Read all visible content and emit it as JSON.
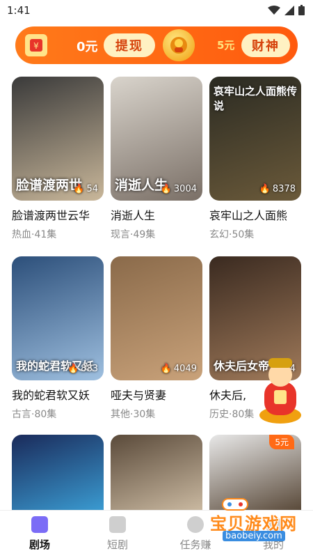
{
  "status_bar": {
    "time": "1:41"
  },
  "banner": {
    "balance": "0元",
    "withdraw_label": "提现",
    "reward": "5元",
    "god_label": "财神"
  },
  "dramas": [
    {
      "poster_title": "脸谱渡两世",
      "views": "54",
      "name": "脸谱渡两世云华",
      "meta": "热血·41集",
      "color1": "#3a3a3a",
      "color2": "#c9b79a"
    },
    {
      "poster_title": "消逝人生",
      "views": "3004",
      "name": "消逝人生",
      "meta": "现言·49集",
      "color1": "#d9d4cc",
      "color2": "#7a6f66"
    },
    {
      "poster_title": "哀牢山之人面熊传说",
      "views": "8378",
      "name": "哀牢山之人面熊",
      "meta": "玄幻·50集",
      "color1": "#2a2a22",
      "color2": "#6b5a3a"
    },
    {
      "poster_title": "我的蛇君软又妖",
      "views": "883",
      "name": "我的蛇君软又妖",
      "meta": "古言·80集",
      "color1": "#2c4f7a",
      "color2": "#9fc0e0"
    },
    {
      "poster_title": "",
      "views": "4049",
      "name": "哑夫与贤妻",
      "meta": "其他·30集",
      "color1": "#8a6a4a",
      "color2": "#c9a27a"
    },
    {
      "poster_title": "休夫后女帝",
      "views": "4",
      "name": "休夫后,",
      "meta": "历史·80集",
      "color1": "#3a2a20",
      "color2": "#a07a5a"
    },
    {
      "poster_title": "",
      "views": "",
      "name": "",
      "meta": "",
      "color1": "#1a2a5a",
      "color2": "#3a9ad0"
    },
    {
      "poster_title": "",
      "views": "",
      "name": "",
      "meta": "",
      "color1": "#5a4a3a",
      "color2": "#c9b8a0"
    },
    {
      "poster_title": "",
      "views": "",
      "name": "",
      "meta": "",
      "color1": "#e8e8e8",
      "color2": "#5a4a3a",
      "tag": "5元"
    }
  ],
  "tabs": [
    {
      "label": "剧场",
      "icon": "film-icon",
      "active": true
    },
    {
      "label": "短剧",
      "icon": "play-icon",
      "active": false
    },
    {
      "label": "任务赚",
      "icon": "coin-icon",
      "active": false
    },
    {
      "label": "我的",
      "icon": "user-icon",
      "active": false
    }
  ],
  "watermark": {
    "main": "宝贝游戏网",
    "url": "baobeiy.com"
  },
  "colors": {
    "accent": "#ff6a16",
    "pill_bg": "#fff1c2",
    "pill_text": "#d6430c"
  }
}
